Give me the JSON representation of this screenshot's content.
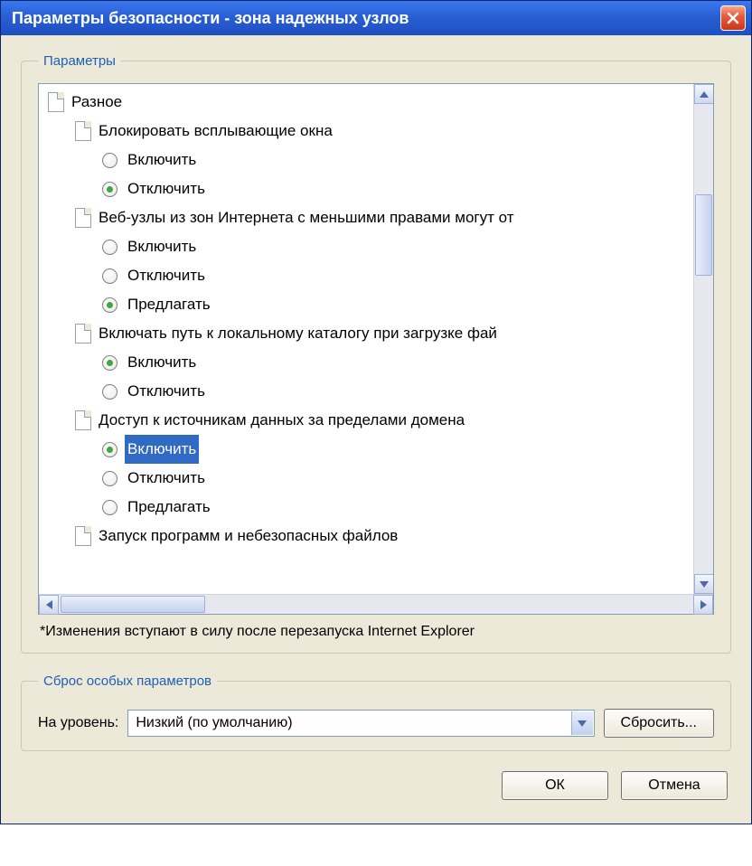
{
  "window": {
    "title": "Параметры безопасности - зона надежных узлов"
  },
  "params_group_label": "Параметры",
  "tree": {
    "root_label": "Разное",
    "items": [
      {
        "label": "Блокировать всплывающие окна",
        "options": [
          {
            "label": "Включить",
            "checked": false
          },
          {
            "label": "Отключить",
            "checked": true
          }
        ]
      },
      {
        "label": "Веб-узлы из зон Интернета с меньшими правами могут от",
        "options": [
          {
            "label": "Включить",
            "checked": false
          },
          {
            "label": "Отключить",
            "checked": false
          },
          {
            "label": "Предлагать",
            "checked": true
          }
        ]
      },
      {
        "label": "Включать путь к локальному каталогу при загрузке фай",
        "options": [
          {
            "label": "Включить",
            "checked": true
          },
          {
            "label": "Отключить",
            "checked": false
          }
        ]
      },
      {
        "label": "Доступ к источникам данных за пределами домена",
        "options": [
          {
            "label": "Включить",
            "checked": true,
            "selected": true
          },
          {
            "label": "Отключить",
            "checked": false
          },
          {
            "label": "Предлагать",
            "checked": false
          }
        ]
      }
    ],
    "partial_next": "Запуск программ и небезопасных файлов"
  },
  "note": "*Изменения вступают в силу после перезапуска Internet Explorer",
  "reset_group_label": "Сброс особых параметров",
  "reset": {
    "level_label": "На уровень:",
    "level_value": "Низкий (по умолчанию)",
    "reset_button": "Сбросить..."
  },
  "footer": {
    "ok": "ОК",
    "cancel": "Отмена"
  }
}
